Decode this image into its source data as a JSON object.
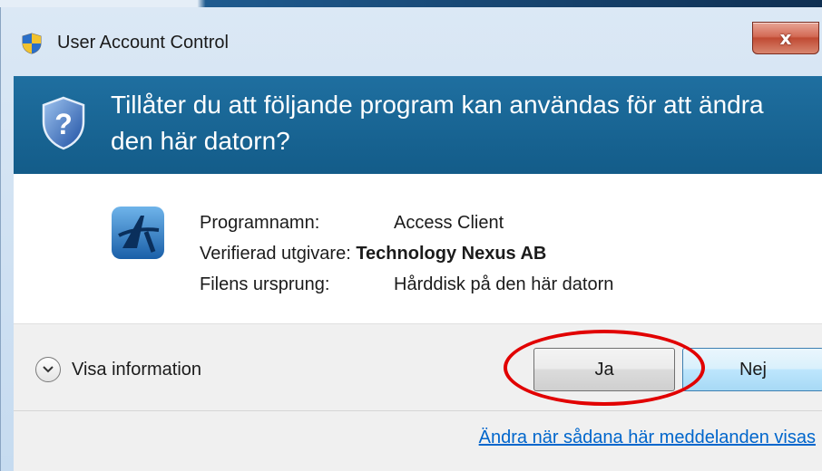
{
  "window": {
    "title": "User Account Control",
    "close_glyph": "x"
  },
  "header": {
    "question": "Tillåter du att följande program kan användas för att ändra den här datorn?"
  },
  "program": {
    "name_label": "Programnamn:",
    "name_value": "Access Client",
    "publisher_label": "Verifierad utgivare:",
    "publisher_value": "Technology Nexus AB",
    "origin_label": "Filens ursprung:",
    "origin_value": "Hårddisk på den här datorn"
  },
  "footer": {
    "details_label": "Visa information",
    "yes_label": "Ja",
    "no_label": "Nej",
    "settings_link": "Ändra när sådana här meddelanden visas"
  },
  "icons": {
    "title": "uac-shield-icon",
    "header": "uac-question-shield-icon",
    "program": "access-client-app-icon",
    "expander": "chevron-down-icon"
  },
  "colors": {
    "header_band": "#135c89",
    "link": "#0066cc",
    "annotation": "#e10000"
  }
}
